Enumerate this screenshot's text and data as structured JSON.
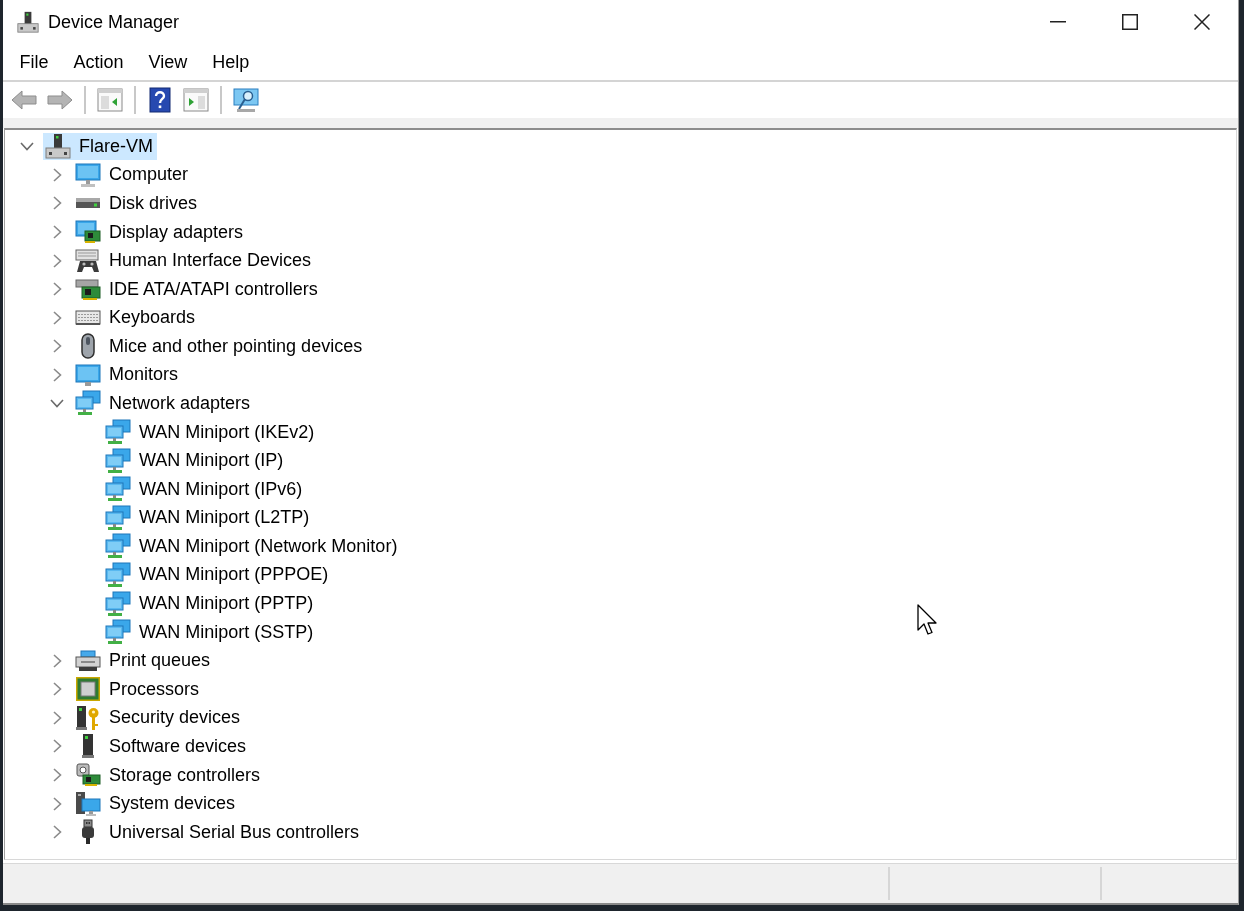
{
  "window": {
    "title": "Device Manager"
  },
  "menu_bar": [
    "File",
    "Action",
    "View",
    "Help"
  ],
  "toolbar": {
    "groups": [
      {
        "buttons": [
          {
            "kind": "back",
            "disabled": true
          },
          {
            "kind": "forward",
            "disabled": true
          }
        ]
      },
      {
        "buttons": [
          {
            "kind": "console-tree",
            "disabled": false
          }
        ]
      },
      {
        "buttons": [
          {
            "kind": "help",
            "disabled": false
          },
          {
            "kind": "action-pane",
            "disabled": false
          }
        ]
      },
      {
        "buttons": [
          {
            "kind": "scan",
            "disabled": false
          }
        ]
      }
    ]
  },
  "tree": {
    "items": [
      {
        "label": "Flare-VM",
        "kind": "host",
        "expanded": true,
        "selected": true,
        "children": [
          {
            "label": "Computer",
            "kind": "computer",
            "expanded": false,
            "selected": false
          },
          {
            "label": "Disk drives",
            "kind": "disk",
            "expanded": false,
            "selected": false
          },
          {
            "label": "Display adapters",
            "kind": "display",
            "expanded": false,
            "selected": false
          },
          {
            "label": "Human Interface Devices",
            "kind": "hid",
            "expanded": false,
            "selected": false
          },
          {
            "label": "IDE ATA/ATAPI controllers",
            "kind": "ide",
            "expanded": false,
            "selected": false
          },
          {
            "label": "Keyboards",
            "kind": "keyboard",
            "expanded": false,
            "selected": false
          },
          {
            "label": "Mice and other pointing devices",
            "kind": "mouse",
            "expanded": false,
            "selected": false
          },
          {
            "label": "Monitors",
            "kind": "monitor",
            "expanded": false,
            "selected": false
          },
          {
            "label": "Network adapters",
            "kind": "network",
            "expanded": true,
            "selected": false,
            "children": [
              {
                "label": "WAN Miniport (IKEv2)",
                "kind": "network",
                "selected": false
              },
              {
                "label": "WAN Miniport (IP)",
                "kind": "network",
                "selected": false
              },
              {
                "label": "WAN Miniport (IPv6)",
                "kind": "network",
                "selected": false
              },
              {
                "label": "WAN Miniport (L2TP)",
                "kind": "network",
                "selected": false
              },
              {
                "label": "WAN Miniport (Network Monitor)",
                "kind": "network",
                "selected": false
              },
              {
                "label": "WAN Miniport (PPPOE)",
                "kind": "network",
                "selected": false
              },
              {
                "label": "WAN Miniport (PPTP)",
                "kind": "network",
                "selected": false
              },
              {
                "label": "WAN Miniport (SSTP)",
                "kind": "network",
                "selected": false
              }
            ]
          },
          {
            "label": "Print queues",
            "kind": "printer",
            "expanded": false,
            "selected": false
          },
          {
            "label": "Processors",
            "kind": "processor",
            "expanded": false,
            "selected": false
          },
          {
            "label": "Security devices",
            "kind": "security",
            "expanded": false,
            "selected": false
          },
          {
            "label": "Software devices",
            "kind": "software",
            "expanded": false,
            "selected": false
          },
          {
            "label": "Storage controllers",
            "kind": "storage",
            "expanded": false,
            "selected": false
          },
          {
            "label": "System devices",
            "kind": "system",
            "expanded": false,
            "selected": false
          },
          {
            "label": "Universal Serial Bus controllers",
            "kind": "usb",
            "expanded": false,
            "selected": false
          }
        ]
      }
    ]
  }
}
